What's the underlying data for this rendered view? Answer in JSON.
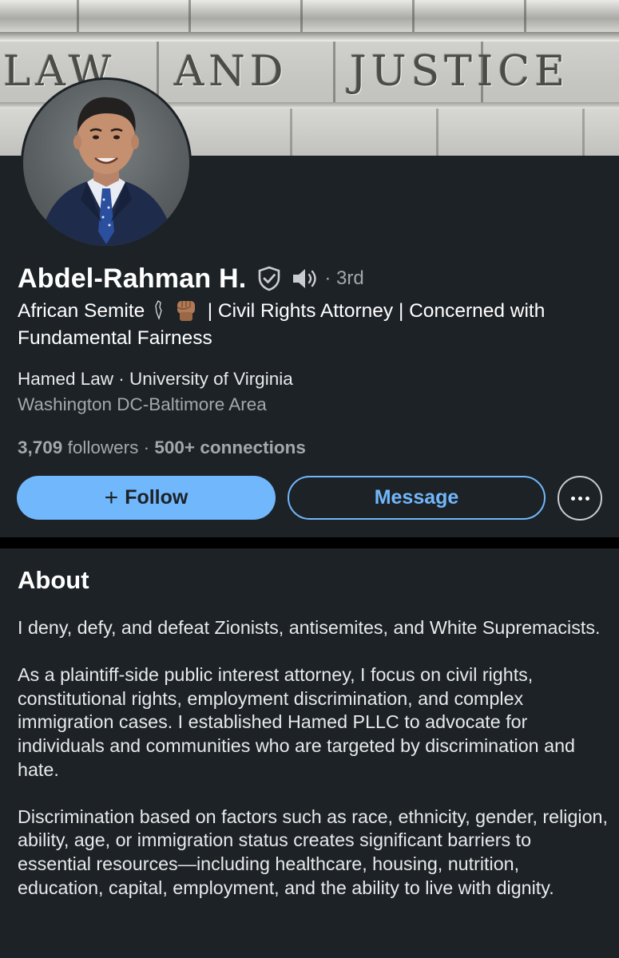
{
  "banner": {
    "engraving_words": [
      "LAW",
      "AND",
      "JUSTICE"
    ]
  },
  "profile": {
    "name": "Abdel-Rahman H.",
    "degree": "· 3rd",
    "headline_before": "African Semite",
    "headline_after": "| Civil Rights Attorney | Concerned with Fundamental Fairness",
    "headline_icons": [
      "palestine-map-icon",
      "raised-fist-icon"
    ],
    "company": "Hamed Law · University of Virginia",
    "location": "Washington DC-Baltimore Area",
    "followers_count": "3,709",
    "followers_label": "followers",
    "separator": "·",
    "connections": "500+ connections"
  },
  "actions": {
    "follow_label": "Follow",
    "follow_icon": "+",
    "message_label": "Message",
    "more_icon": "ellipsis-icon"
  },
  "about": {
    "title": "About",
    "paragraphs": [
      "I deny, defy, and defeat Zionists, antisemites, and White Supremacists.",
      "As a plaintiff-side public interest attorney, I focus on civil rights, constitutional rights, employment discrimination, and complex immigration cases. I established Hamed PLLC to advocate for individuals and communities who are targeted by discrimination and hate.",
      "Discrimination based on factors such as race, ethnicity, gender, religion, ability, age, or immigration status creates significant barriers to essential resources—including healthcare, housing, nutrition, education, capital, employment, and the ability to live with dignity."
    ]
  },
  "colors": {
    "background": "#000000",
    "card": "#1d2226",
    "accent": "#71b7fb",
    "text_primary": "#ffffff",
    "text_secondary": "#a3a8ac"
  }
}
